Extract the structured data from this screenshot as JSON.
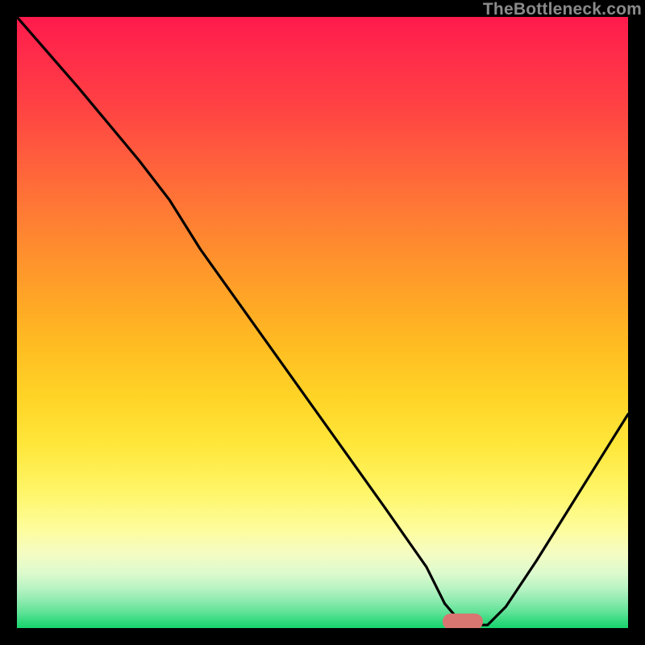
{
  "watermark": "TheBottleneck.com",
  "marker": {
    "x_pct": 73,
    "y_pct": 99.0,
    "color": "#d97672"
  },
  "chart_data": {
    "type": "line",
    "title": "",
    "xlabel": "",
    "ylabel": "",
    "xlim": [
      0,
      100
    ],
    "ylim": [
      0,
      100
    ],
    "x": [
      0,
      10,
      20,
      25,
      30,
      40,
      50,
      60,
      67,
      70,
      73,
      77,
      80,
      85,
      90,
      95,
      100
    ],
    "values": [
      100,
      88.5,
      76.5,
      70,
      62,
      48,
      34,
      20,
      10,
      4,
      0.5,
      0.5,
      3.5,
      11,
      19,
      27,
      35
    ],
    "gradient_stops": [
      {
        "pct": 0,
        "color": "#ff1a4c"
      },
      {
        "pct": 50,
        "color": "#ffb524"
      },
      {
        "pct": 80,
        "color": "#fffb80"
      },
      {
        "pct": 100,
        "color": "#17d46d"
      }
    ],
    "optimum_x_pct": 75
  }
}
